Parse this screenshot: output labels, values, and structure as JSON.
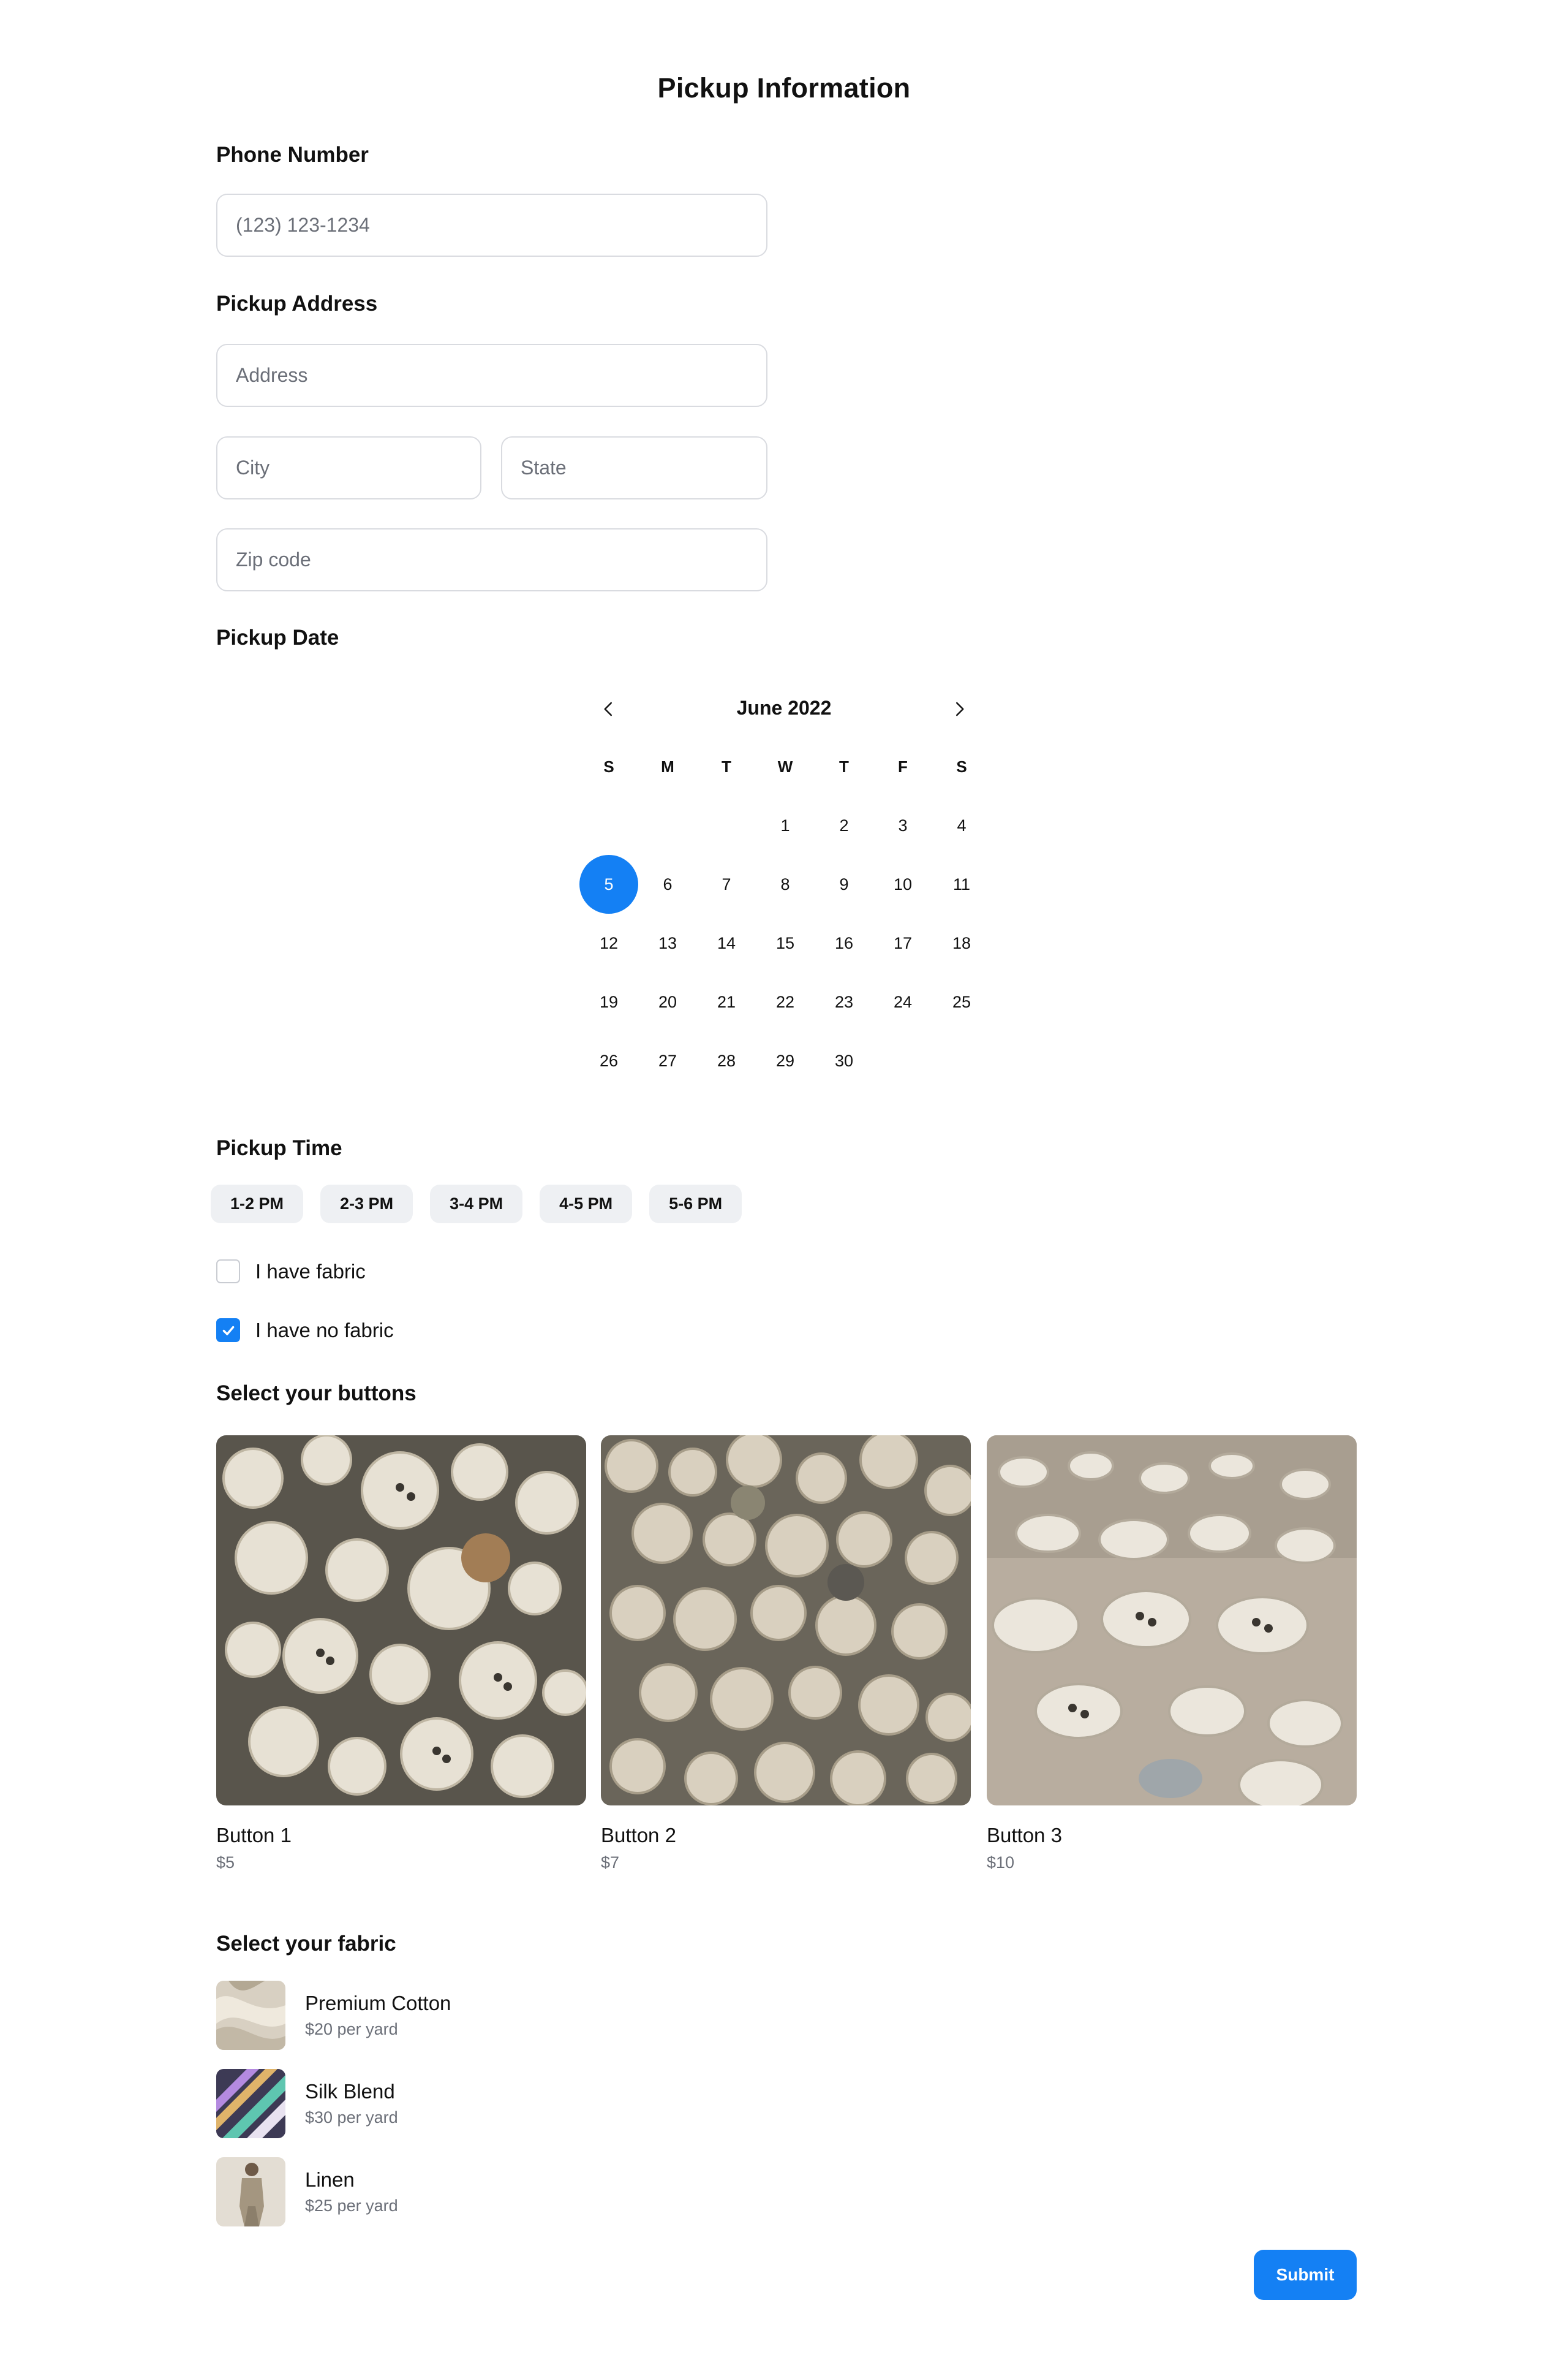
{
  "page": {
    "title": "Pickup Information"
  },
  "phone": {
    "label": "Phone Number",
    "placeholder": "(123) 123-1234"
  },
  "address": {
    "label": "Pickup Address",
    "address_placeholder": "Address",
    "city_placeholder": "City",
    "state_placeholder": "State",
    "zip_placeholder": "Zip code"
  },
  "date": {
    "label": "Pickup Date",
    "month_label": "June 2022",
    "weekdays": [
      "S",
      "M",
      "T",
      "W",
      "T",
      "F",
      "S"
    ],
    "days": [
      "1",
      "2",
      "3",
      "4",
      "5",
      "6",
      "7",
      "8",
      "9",
      "10",
      "11",
      "12",
      "13",
      "14",
      "15",
      "16",
      "17",
      "18",
      "19",
      "20",
      "21",
      "22",
      "23",
      "24",
      "25",
      "26",
      "27",
      "28",
      "29",
      "30"
    ],
    "selected_day": "5",
    "accent": "#1480f4"
  },
  "time": {
    "label": "Pickup Time",
    "slots": [
      "1-2 PM",
      "2-3 PM",
      "3-4 PM",
      "4-5 PM",
      "5-6 PM"
    ]
  },
  "fabric_options": {
    "have_fabric": {
      "label": "I have fabric",
      "checked": false
    },
    "no_fabric": {
      "label": "I have no fabric",
      "checked": true
    }
  },
  "buttons": {
    "label": "Select your buttons",
    "items": [
      {
        "name": "Button 1",
        "price": "$5"
      },
      {
        "name": "Button 2",
        "price": "$7"
      },
      {
        "name": "Button 3",
        "price": "$10"
      }
    ]
  },
  "fabrics": {
    "label": "Select your fabric",
    "items": [
      {
        "name": "Premium Cotton",
        "price": "$20 per yard"
      },
      {
        "name": "Silk Blend",
        "price": "$30 per yard"
      },
      {
        "name": "Linen",
        "price": "$25 per yard"
      }
    ]
  },
  "submit": {
    "label": "Submit"
  }
}
